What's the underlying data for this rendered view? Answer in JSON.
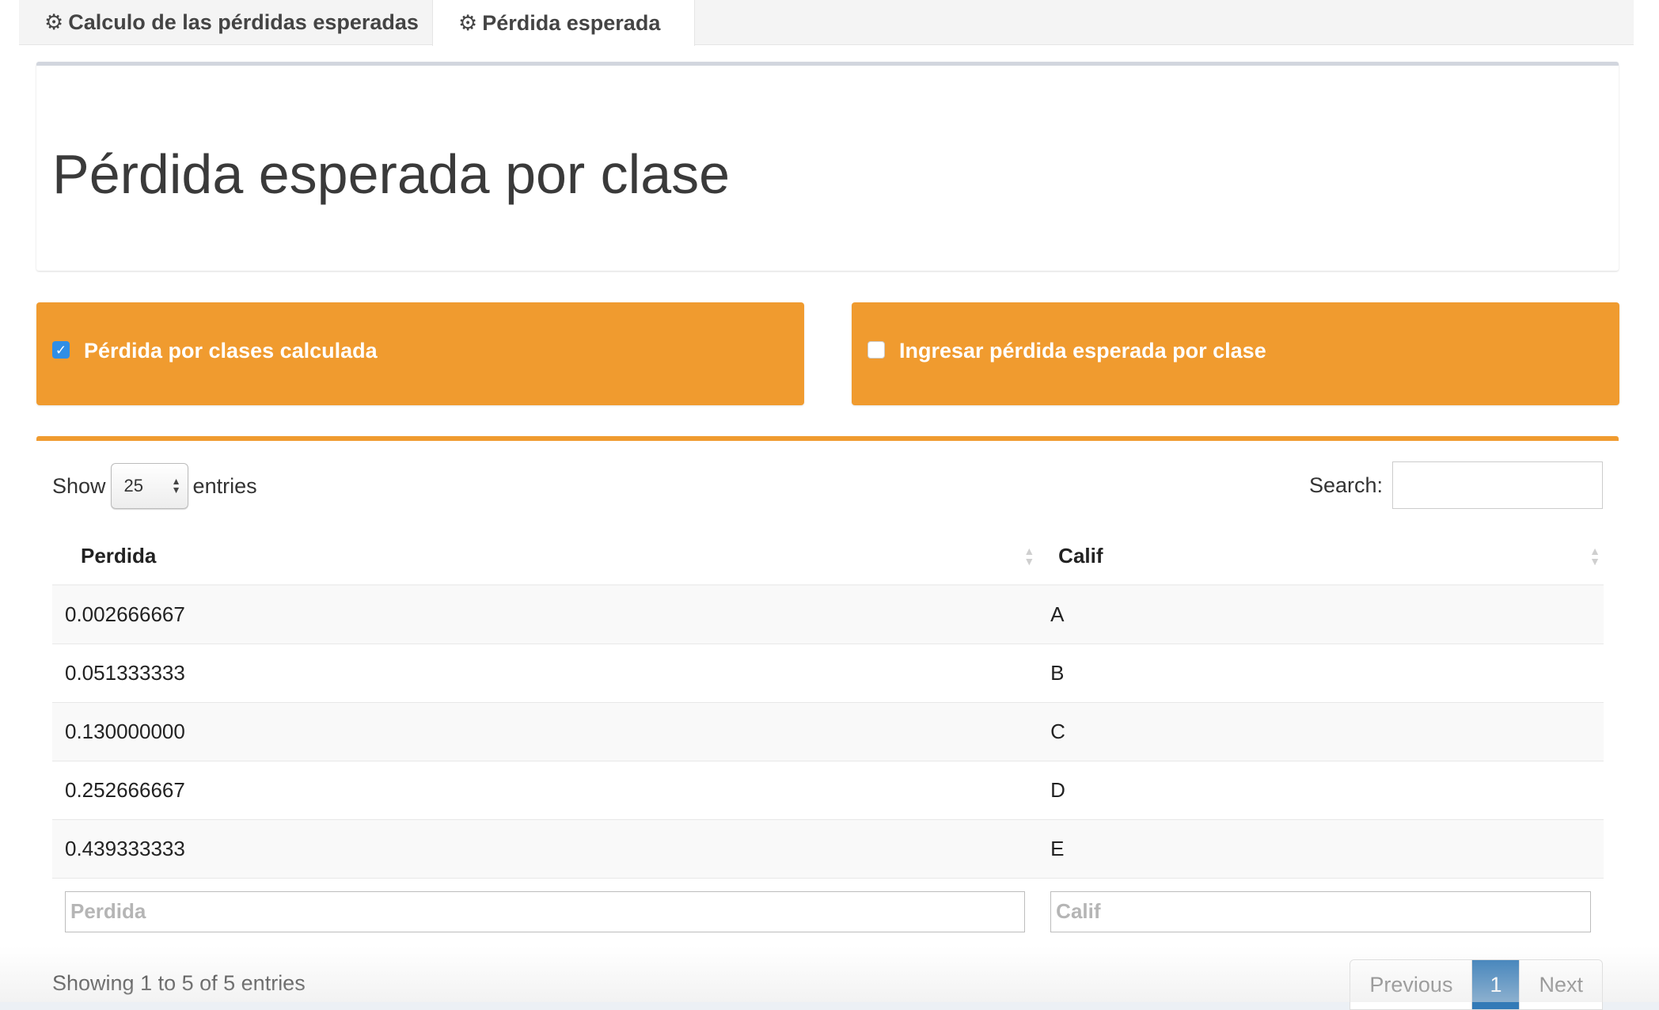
{
  "tabs": [
    {
      "label": "Calculo de las pérdidas esperadas",
      "icon": "gear-icon",
      "active": false
    },
    {
      "label": "Pérdida esperada",
      "icon": "gear-icon",
      "active": true
    }
  ],
  "header": {
    "title": "Pérdida esperada por clase"
  },
  "options": {
    "left": {
      "label": "Pérdida por clases calculada",
      "checked": true
    },
    "right": {
      "label": "Ingresar pérdida esperada por clase",
      "checked": false
    },
    "color": "#f09b2f"
  },
  "table": {
    "show_label": "Show",
    "entries_label": "entries",
    "page_length": "25",
    "search_label": "Search:",
    "columns": [
      "Perdida",
      "Calif"
    ],
    "rows": [
      [
        "0.002666667",
        "A"
      ],
      [
        "0.051333333",
        "B"
      ],
      [
        "0.130000000",
        "C"
      ],
      [
        "0.252666667",
        "D"
      ],
      [
        "0.439333333",
        "E"
      ]
    ],
    "filter_placeholders": [
      "Perdida",
      "Calif"
    ],
    "info": "Showing 1 to 5 of 5 entries",
    "pagination": {
      "previous": "Previous",
      "current": "1",
      "next": "Next"
    }
  }
}
